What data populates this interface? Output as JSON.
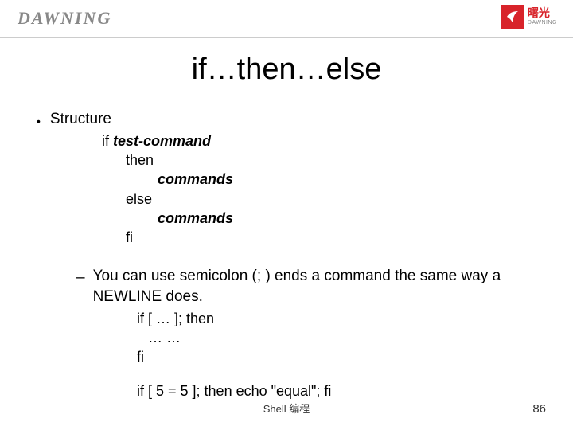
{
  "brand_left": "DAWNING",
  "logo_cn": "曙光",
  "logo_en": "DAWNING",
  "title": "if…then…else",
  "bullet_label": "Structure",
  "struct": {
    "if": "if ",
    "test": "test-command",
    "then": "then",
    "cmds1": "commands",
    "else_": "else",
    "cmds2": "commands",
    "fi": "fi"
  },
  "semi_text": "You can use semicolon (; ) ends a command the same way a NEWLINE does.",
  "code2": {
    "l1": "if [ … ]; then",
    "l2": "… …",
    "l3": "fi"
  },
  "code3": "if [ 5 = 5 ]; then echo \"equal\"; fi",
  "footer": "Shell 编程",
  "page": "86"
}
